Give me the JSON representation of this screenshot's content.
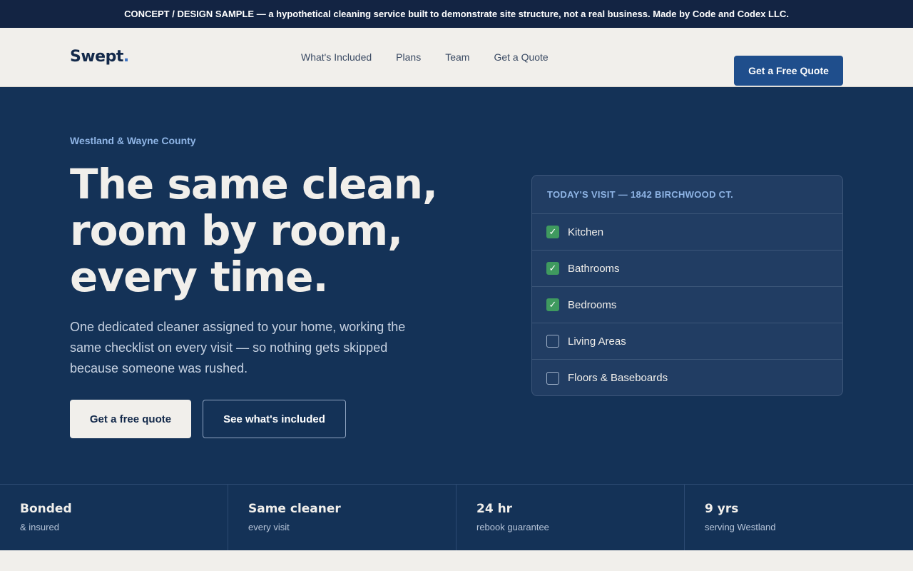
{
  "banner": {
    "lead": "CONCEPT / DESIGN SAMPLE",
    "text": " — a hypothetical cleaning service built to demonstrate site structure, not a real business. Made by ",
    "maker": "Code and Codex LLC."
  },
  "nav": {
    "logo": "Swept",
    "logo_dot": ".",
    "links": [
      "What's Included",
      "Plans",
      "Team",
      "Get a Quote"
    ],
    "cta": "Get a Free Quote"
  },
  "hero": {
    "eyebrow": "Westland & Wayne County",
    "headline": "The same clean, room by room, every time.",
    "subtext": "One dedicated cleaner assigned to your home, working the same checklist on every visit — so nothing gets skipped because someone was rushed.",
    "primary_button": "Get a free quote",
    "secondary_button": "See what's included"
  },
  "visit_card": {
    "title": "TODAY'S VISIT — 1842 BIRCHWOOD CT.",
    "items": [
      {
        "label": "Kitchen",
        "checked": true
      },
      {
        "label": "Bathrooms",
        "checked": true
      },
      {
        "label": "Bedrooms",
        "checked": true
      },
      {
        "label": "Living Areas",
        "checked": false
      },
      {
        "label": "Floors & Baseboards",
        "checked": false
      }
    ],
    "check_glyph": "✓"
  },
  "stats": [
    {
      "title": "Bonded",
      "sub": "& insured"
    },
    {
      "title": "Same cleaner",
      "sub": "every visit"
    },
    {
      "title": "24 hr",
      "sub": "rebook guarantee"
    },
    {
      "title": "9 yrs",
      "sub": "serving Westland"
    }
  ],
  "colors": {
    "navy": "#143257",
    "banner": "#132443",
    "accent_blue": "#1f4e8c",
    "check_green": "#3f9a5f",
    "cream": "#f1efeb"
  }
}
